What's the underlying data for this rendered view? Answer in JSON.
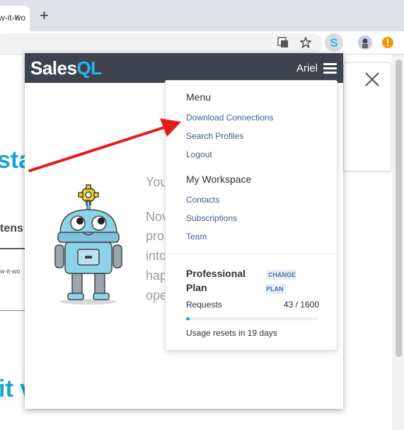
{
  "browser": {
    "tab_title": "w-it-wo",
    "tab_close": "×",
    "new_tab": "+"
  },
  "background_page": {
    "heading_fragment_1": "sta",
    "tab_fragment": "tens",
    "small_fragment": "w-it-wo",
    "heading_fragment_2": "it v"
  },
  "popup": {
    "logo_prefix": "Sales",
    "logo_suffix": "QL",
    "user_name": "Ariel",
    "body_lines": [
      "You",
      "Nov",
      "pro",
      "into",
      "hap",
      "ope"
    ]
  },
  "menu": {
    "menu_heading": "Menu",
    "items": [
      "Download Connections",
      "Search Profiles",
      "Logout"
    ],
    "workspace_heading": "My Workspace",
    "workspace_items": [
      "Contacts",
      "Subscriptions",
      "Team"
    ],
    "plan_name": "Professional Plan",
    "change_plan": "CHANGE PLAN",
    "requests_label": "Requests",
    "requests_value": "43 / 1600",
    "requests_fraction": 0.027,
    "reset_text": "Usage resets in 19 days"
  },
  "colors": {
    "header_bg": "#3f4350",
    "brand_blue": "#29b6e6",
    "link": "#3a5f8f",
    "arrow": "#e31b1b"
  }
}
